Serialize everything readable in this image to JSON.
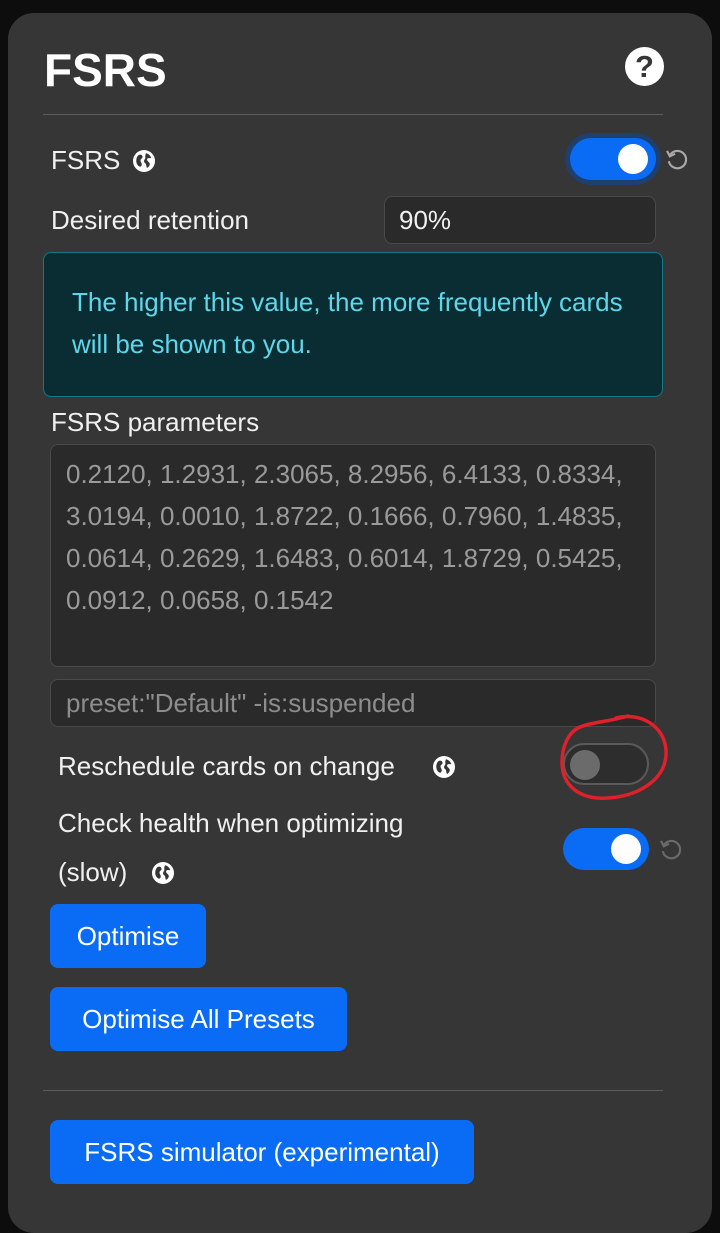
{
  "header": {
    "title": "FSRS",
    "help_icon": "question-circle-icon",
    "help_glyph": "?"
  },
  "fsrs_toggle": {
    "label": "FSRS",
    "enabled": true,
    "icon": "globe-icon",
    "revert_icon": "revert-icon"
  },
  "desired_retention": {
    "label": "Desired retention",
    "value": "90%"
  },
  "info": {
    "text": "The higher this value, the more frequently cards will be shown to you."
  },
  "fsrs_parameters": {
    "label": "FSRS parameters",
    "value": "0.2120, 1.2931, 2.3065, 8.2956, 6.4133, 0.8334, 3.0194, 0.0010, 1.8722, 0.1666, 0.7960, 1.4835, 0.0614, 0.2629, 1.6483, 0.6014, 1.8729, 0.5425, 0.0912, 0.0658, 0.1542"
  },
  "search": {
    "value": "preset:\"Default\" -is:suspended"
  },
  "reschedule": {
    "label": "Reschedule cards on change",
    "enabled": false,
    "icon": "globe-icon"
  },
  "health_check": {
    "label_line1": "Check health when optimizing",
    "label_line2": "(slow)",
    "enabled": true,
    "icon": "globe-icon",
    "revert_icon": "revert-icon"
  },
  "buttons": {
    "optimise": "Optimise",
    "optimise_all": "Optimise All Presets",
    "simulator": "FSRS simulator (experimental)"
  },
  "colors": {
    "background": "#363636",
    "accent": "#0a6cf5",
    "info_text": "#5fd6ea",
    "annotation": "#e0202a"
  }
}
